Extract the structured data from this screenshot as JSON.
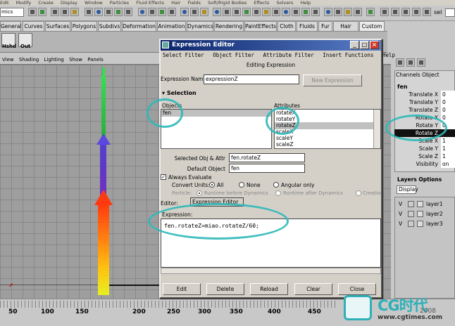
{
  "menubar": [
    "Edit",
    "Modify",
    "Create",
    "Display",
    "Window",
    "Particles",
    "Fluid Effects",
    "Hair",
    "Fields",
    "Soft/Rigid Bodies",
    "Effects",
    "Solvers",
    "Help"
  ],
  "status": {
    "mode": "mics",
    "right_label": "sel"
  },
  "shelf_tabs": [
    "General",
    "Curves",
    "Surfaces",
    "Polygons",
    "Subdivs",
    "Deformation",
    "Animation",
    "Dynamics",
    "Rendering",
    "PaintEffects",
    "Cloth",
    "Fluids",
    "Fur",
    "Hair",
    "Custom"
  ],
  "shelf_buttons": [
    {
      "label": "Hshd"
    },
    {
      "label": "Out"
    }
  ],
  "viewport_menu": [
    "View",
    "Shading",
    "Lighting",
    "Show",
    "Panels"
  ],
  "timeline": {
    "ticks": [
      "50",
      "100",
      "150",
      "200",
      "250",
      "300",
      "350",
      "400",
      "450"
    ]
  },
  "channel_box": {
    "menu": [
      "Channels",
      "Object"
    ],
    "object": "fen",
    "channels": [
      {
        "name": "Translate X",
        "value": "0",
        "selected": false
      },
      {
        "name": "Translate Y",
        "value": "0",
        "selected": false
      },
      {
        "name": "Translate Z",
        "value": "0",
        "selected": false
      },
      {
        "name": "Rotate X",
        "value": "0",
        "selected": false
      },
      {
        "name": "Rotate Y",
        "value": "0",
        "selected": false
      },
      {
        "name": "Rotate Z",
        "value": "",
        "selected": true
      },
      {
        "name": "Scale X",
        "value": "1",
        "selected": false
      },
      {
        "name": "Scale Y",
        "value": "1",
        "selected": false
      },
      {
        "name": "Scale Z",
        "value": "1",
        "selected": false
      },
      {
        "name": "Visibility",
        "value": "on",
        "selected": false
      }
    ]
  },
  "layers": {
    "header": "Layers  Options",
    "display": "Display",
    "items": [
      {
        "visible": "V",
        "name": "layer1"
      },
      {
        "visible": "V",
        "name": "layer2"
      },
      {
        "visible": "V",
        "name": "layer3"
      }
    ]
  },
  "expression_editor": {
    "title": "Expression Editor",
    "menu": [
      "Select Filter",
      "Object Filter",
      "Attribute Filter",
      "Insert Functions",
      "Help"
    ],
    "editing_label": "Editing Expression",
    "name_label": "Expression Name",
    "name_value": "expressionZ",
    "new_button": "New Expression",
    "selection_header": "Selection",
    "objects_label": "Objects",
    "objects": [
      "fen"
    ],
    "attributes_label": "Attributes",
    "attributes": [
      {
        "name": "rotateX",
        "selected": false
      },
      {
        "name": "rotateY",
        "selected": false
      },
      {
        "name": "rotateZ",
        "selected": true
      },
      {
        "name": "scaleX",
        "selected": false
      },
      {
        "name": "scaleY",
        "selected": false
      },
      {
        "name": "scaleZ",
        "selected": false
      }
    ],
    "selected_label": "Selected Obj & Attr",
    "selected_value": "fen.rotateZ",
    "default_label": "Default Object",
    "default_value": "fen",
    "always_evaluate": "Always Evaluate",
    "convert_label": "Convert Units:",
    "convert_options": [
      "All",
      "None",
      "Angular only"
    ],
    "particle_label": "Particle:",
    "particle_options": [
      "Runtime before Dynamics",
      "Runtime after Dynamics",
      "Creation"
    ],
    "editor_label": "Editor:",
    "editor_value": "Expression Editor",
    "expression_label": "Expression:",
    "expression": "fen.rotateZ=miao.rotateZ/60;",
    "buttons": [
      "Edit",
      "Delete",
      "Reload",
      "Clear",
      "Close"
    ]
  },
  "watermark": {
    "brand": "CG时代",
    "year": "2008",
    "url": "www.cgtimes.com"
  },
  "colors": {
    "annotation": "#2fb8b8",
    "title_bar": "#0a246a"
  }
}
